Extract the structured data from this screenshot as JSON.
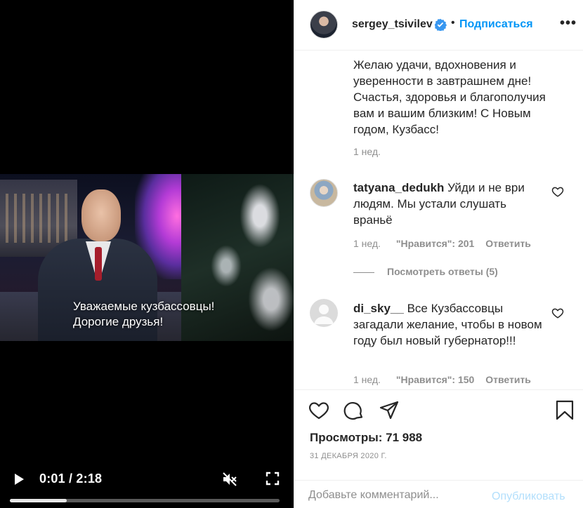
{
  "video": {
    "subtitle_line1": "Уважаемые кузбассовцы!",
    "subtitle_line2": "Дорогие друзья!",
    "time": "0:01 / 2:18",
    "progress_fraction": 0.21,
    "icons": {
      "play": "play-icon",
      "mute": "muted-icon",
      "fullscreen": "fullscreen-icon"
    }
  },
  "header": {
    "username": "sergey_tsivilev",
    "separator": "•",
    "follow_label": "Подписаться",
    "more": "•••"
  },
  "caption": {
    "text": "Желаю удачи, вдохновения и уверенности в завтрашнем дне! Счастья, здоровья и благополучия вам и вашим близким! С Новым годом, Кузбасс!",
    "time": "1 нед."
  },
  "comments": [
    {
      "user": "tatyana_dedukh",
      "text": "Уйди и не ври людям. Мы устали слушать враньё",
      "time": "1 нед.",
      "likes": "\"Нравится\": 201",
      "reply": "Ответить"
    },
    {
      "user": "di_sky__",
      "text": "Все Кузбассовцы загадали желание, чтобы в новом году был новый губернатор!!!",
      "time": "1 нед.",
      "likes": "\"Нравится\": 150",
      "reply": "Ответить"
    }
  ],
  "view_replies": "Посмотреть ответы (5)",
  "actions": {
    "icons": [
      "heart-icon",
      "comment-icon",
      "share-icon",
      "bookmark-icon"
    ],
    "views": "Просмотры: 71 988",
    "date": "31 ДЕКАБРЯ 2020 Г."
  },
  "add_comment": {
    "placeholder": "Добавьте комментарий...",
    "publish_label": "Опубликовать"
  },
  "colors": {
    "accent": "#0095f6",
    "publish_disabled": "#b2dffc",
    "muted_text": "#8e8e8e"
  }
}
